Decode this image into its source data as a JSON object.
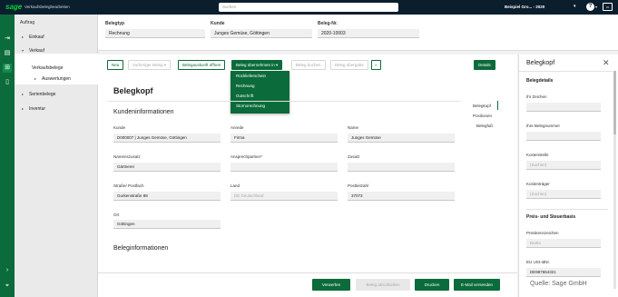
{
  "topbar": {
    "logo": "sage",
    "app_title": "Verkaufsbelegbearbeiten",
    "search_placeholder": "Suchen",
    "company": "Beispiel Gro... - 2020",
    "company_chevron": "▾",
    "help_glyph": "?",
    "help_chevron": "▾",
    "user_glyph": "▭"
  },
  "rail": {
    "icons": [
      "app-icon",
      "list-icon",
      "grid-icon",
      "document-icon",
      "expand-icon",
      "pin-icon"
    ],
    "icon_glyphs": [
      "⇥",
      "▤",
      "⊞",
      "▯",
      "›",
      "⌖"
    ]
  },
  "nav": {
    "header": "Auftrag",
    "arrow_collapsed": "▸",
    "arrow_expanded": "▾",
    "items": [
      {
        "label": "Einkauf",
        "expanded": false
      },
      {
        "label": "Verkauf",
        "expanded": true
      },
      {
        "label": "Serienbelege",
        "expanded": false
      },
      {
        "label": "Inventur",
        "expanded": false
      }
    ],
    "sub_items": [
      "Verkaufsbelege",
      "Auswertungen"
    ]
  },
  "header": {
    "belegtyp_label": "Belegtyp",
    "belegtyp_value": "Rechnung",
    "kunde_label": "Kunde",
    "kunde_value": "Junges Gemüse, Göttingen",
    "belegnr_label": "Beleg-Nr.",
    "belegnr_value": "2020-10003"
  },
  "toolbar": {
    "neu": "Neu",
    "vorheriger": "Vorheriger Beleg",
    "vorheriger_chevron": "▾",
    "belegauskunft": "Belegauskunft öffnen",
    "uebernehmen": "Beleg übernehmen in",
    "uebernehmen_chevron": "▾",
    "buchen": "Beleg buchen",
    "weitergabe": "Beleg übergabe",
    "more": "»",
    "details": "Details"
  },
  "dropdown": {
    "items": [
      "Rücklieferschein",
      "Rechnung",
      "Gutschrift",
      "Stornorechnung"
    ]
  },
  "main": {
    "title": "Belegkopf",
    "section1": "Kundeninformationen",
    "section2": "Beleginformationen",
    "fields": {
      "kunde_label": "Kunde",
      "kunde_value": "D000007 | Junges Gemüse, Göttingen",
      "anrede_label": "Anrede",
      "anrede_value": "Firma",
      "name_label": "Name",
      "name_value": "Junges Gemüse",
      "namenszusatz_label": "Namenszusatz",
      "namenszusatz_value": "Gärtnerei",
      "ansprechpartner_label": "Ansprechpartner*",
      "ansprechpartner_value": "",
      "zusatz_label": "Zusatz",
      "zusatz_value": "",
      "strasse_label": "Straße/ Postfach",
      "strasse_value": "Gurkenstraße 88",
      "land_label": "Land",
      "land_value": "DE  Deutschland",
      "plz_label": "Postleitzahl",
      "plz_value": "37073",
      "ort_label": "Ort",
      "ort_value": "Göttingen"
    },
    "anchors": [
      "Belegkopf",
      "Positionen",
      "Belegfuß"
    ]
  },
  "bottom": {
    "verwerfen": "Verwerfen",
    "abschliessen": "Beleg abschließen",
    "drucken": "Drucken",
    "email": "E-Mail versenden"
  },
  "right_panel": {
    "title": "Belegkopf",
    "close": "✕",
    "belegdetails": "Belegdetails",
    "ihr_zeichen_label": "Ihr Zeichen",
    "ihr_zeichen_value": "",
    "ihre_belegnummer_label": "Ihre Belegnummer",
    "ihre_belegnummer_value": "",
    "kostenstelle_label": "Kostenstelle",
    "kostenstelle_value": "(Suchen)",
    "kostentraeger_label": "Kostenträger",
    "kostentraeger_value": "(Suchen)",
    "preis_steuer": "Preis- und Steuerbasis",
    "preiskennzeichen_label": "Preiskennzeichen",
    "preiskennzeichen_value": "Brutto",
    "eu_label": "EU USt-IdNr.",
    "eu_value": "DE987654321",
    "watermark": "Quelle: Sage GmbH"
  }
}
